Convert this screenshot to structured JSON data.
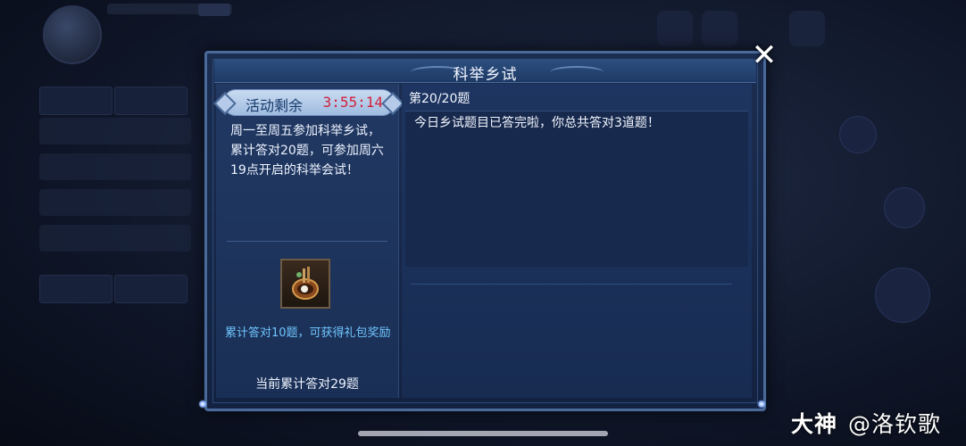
{
  "modal": {
    "title": "科举乡试",
    "close_icon": "close-icon"
  },
  "left_panel": {
    "timer_label": "活动剩余",
    "timer_value": "3:55:14",
    "description": "周一至周五参加科举乡试，累计答对20题，可参加周六19点开启的科举会试！",
    "reward_icon": "reward-bag-icon",
    "reward_note": "累计答对10题，可获得礼包奖励",
    "total_correct": "当前累计答对29题"
  },
  "right_panel": {
    "question_number": "第20/20题",
    "answer_message": "今日乡试题目已答完啦，你总共答对3道题！"
  },
  "watermark": {
    "brand": "大神",
    "handle": "@洛钦歌"
  },
  "colors": {
    "timer_red": "#d2213a",
    "reward_note_blue": "#6fc6ff",
    "frame_blue": "#4a6a9a"
  }
}
